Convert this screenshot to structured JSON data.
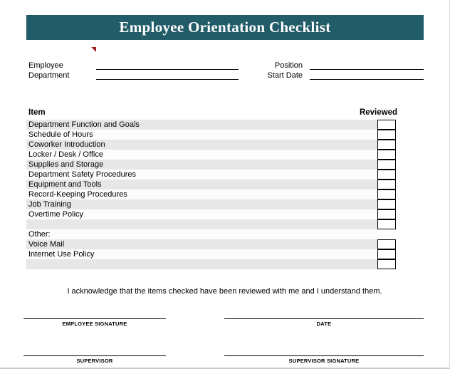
{
  "document": {
    "title": "Employee Orientation Checklist",
    "banner_color": "#225C68",
    "title_color": "#FFFFFF"
  },
  "form_fields": {
    "employee_label": "Employee",
    "employee_value": "",
    "department_label": "Department",
    "department_value": "",
    "position_label": "Position",
    "position_value": "",
    "start_date_label": "Start Date",
    "start_date_value": ""
  },
  "table": {
    "header_item": "Item",
    "header_reviewed": "Reviewed",
    "shaded_row_color": "#E7E7E7",
    "plain_row_color": "#FCFCFC",
    "rows": [
      {
        "label": "Department Function and Goals",
        "shaded": true,
        "checkbox": true,
        "checked": false
      },
      {
        "label": "Schedule of Hours",
        "shaded": false,
        "checkbox": true,
        "checked": false
      },
      {
        "label": "Coworker Introduction",
        "shaded": true,
        "checkbox": true,
        "checked": false
      },
      {
        "label": "Locker / Desk / Office",
        "shaded": false,
        "checkbox": true,
        "checked": false
      },
      {
        "label": "Supplies and Storage",
        "shaded": true,
        "checkbox": true,
        "checked": false
      },
      {
        "label": "Department Safety Procedures",
        "shaded": false,
        "checkbox": true,
        "checked": false
      },
      {
        "label": "Equipment and Tools",
        "shaded": true,
        "checkbox": true,
        "checked": false
      },
      {
        "label": "Record-Keeping Procedures",
        "shaded": false,
        "checkbox": true,
        "checked": false
      },
      {
        "label": "Job Training",
        "shaded": true,
        "checkbox": true,
        "checked": false
      },
      {
        "label": "Overtime Policy",
        "shaded": false,
        "checkbox": true,
        "checked": false
      },
      {
        "label": "",
        "shaded": true,
        "checkbox": true,
        "checked": false
      },
      {
        "label": "Other:",
        "shaded": false,
        "checkbox": false,
        "checked": false
      },
      {
        "label": "Voice Mail",
        "shaded": true,
        "checkbox": true,
        "checked": false
      },
      {
        "label": "Internet Use Policy",
        "shaded": false,
        "checkbox": true,
        "checked": false
      },
      {
        "label": "",
        "shaded": true,
        "checkbox": true,
        "checked": false
      }
    ]
  },
  "acknowledgement": "I acknowledge that the items checked have been reviewed with me and I understand them.",
  "signatures": {
    "employee_signature_caption": "EMPLOYEE SIGNATURE",
    "date_caption": "DATE",
    "supervisor_caption": "SUPERVISOR",
    "supervisor_signature_caption": "SUPERVISOR SIGNATURE"
  }
}
